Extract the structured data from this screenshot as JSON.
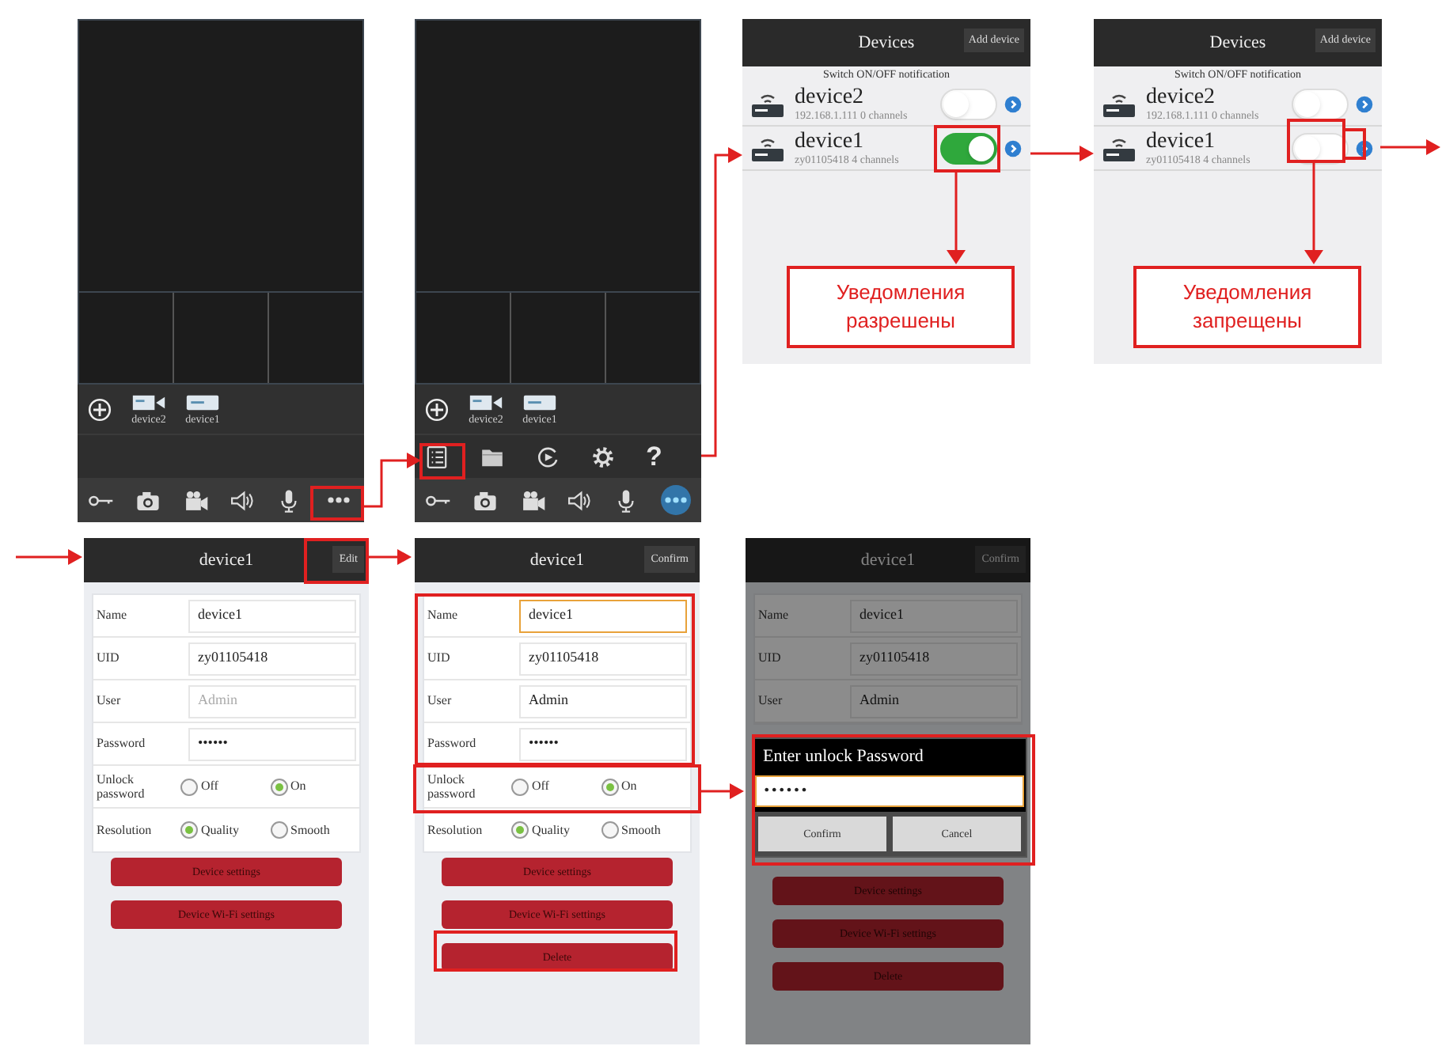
{
  "live_view_screens": [
    {
      "devices": [
        {
          "kind": "camera",
          "label": "device2"
        },
        {
          "kind": "recorder",
          "label": "device1"
        }
      ],
      "more_active": false
    },
    {
      "devices": [
        {
          "kind": "camera",
          "label": "device2"
        },
        {
          "kind": "recorder",
          "label": "device1"
        }
      ],
      "menu": [
        {
          "kind": "list"
        },
        {
          "kind": "folder"
        },
        {
          "kind": "playback"
        },
        {
          "kind": "settings"
        },
        {
          "kind": "help",
          "glyph": "?"
        }
      ],
      "more_active": true
    }
  ],
  "device_list_screens": [
    {
      "title": "Devices",
      "add_button": "Add device",
      "notice": "Switch ON/OFF notification",
      "devices": [
        {
          "name": "device2",
          "detail": "192.168.1.111 0 channels",
          "on": false
        },
        {
          "name": "device1",
          "detail": "zy01105418 4 channels",
          "on": true
        }
      ],
      "callout": "Уведомления разрешены"
    },
    {
      "title": "Devices",
      "add_button": "Add device",
      "notice": "Switch ON/OFF notification",
      "devices": [
        {
          "name": "device2",
          "detail": "192.168.1.111 0 channels",
          "on": false
        },
        {
          "name": "device1",
          "detail": "zy01105418 4 channels",
          "on": false
        }
      ],
      "callout": "Уведомления запрещены"
    }
  ],
  "device_edit_screens": [
    {
      "title": "device1",
      "action_button": "Edit",
      "fields": [
        {
          "label": "Name",
          "value": "device1",
          "focused": false
        },
        {
          "label": "UID",
          "value": "zy01105418",
          "focused": false
        },
        {
          "label": "User",
          "placeholder": "Admin",
          "focused": false
        },
        {
          "label": "Password",
          "value": "••••••",
          "focused": false
        }
      ],
      "options": [
        {
          "label": "Unlock password",
          "choices": [
            {
              "label": "Off",
              "selected": false
            },
            {
              "label": "On",
              "selected": true
            }
          ]
        },
        {
          "label": "Resolution",
          "choices": [
            {
              "label": "Quality",
              "selected": true
            },
            {
              "label": "Smooth",
              "selected": false
            }
          ]
        }
      ],
      "buttons": [
        "Device settings",
        "Device Wi-Fi settings"
      ]
    },
    {
      "title": "device1",
      "action_button": "Confirm",
      "fields": [
        {
          "label": "Name",
          "value": "device1",
          "focused": true
        },
        {
          "label": "UID",
          "value": "zy01105418",
          "focused": false
        },
        {
          "label": "User",
          "value": "Admin",
          "focused": false
        },
        {
          "label": "Password",
          "value": "••••••",
          "focused": false
        }
      ],
      "options": [
        {
          "label": "Unlock password",
          "choices": [
            {
              "label": "Off",
              "selected": false
            },
            {
              "label": "On",
              "selected": true
            }
          ]
        },
        {
          "label": "Resolution",
          "choices": [
            {
              "label": "Quality",
              "selected": true
            },
            {
              "label": "Smooth",
              "selected": false
            }
          ]
        }
      ],
      "buttons": [
        "Device settings",
        "Device Wi-Fi settings",
        "Delete"
      ]
    },
    {
      "title": "device1",
      "action_button": "Confirm",
      "fields": [
        {
          "label": "Name",
          "value": "device1",
          "focused": false
        },
        {
          "label": "UID",
          "value": "zy01105418",
          "focused": false
        },
        {
          "label": "User",
          "value": "Admin",
          "focused": false
        }
      ],
      "buttons": [
        "Device settings",
        "Device Wi-Fi settings",
        "Delete"
      ],
      "dialog": {
        "title": "Enter unlock Password",
        "value": "••••••",
        "buttons": [
          "Confirm",
          "Cancel"
        ]
      }
    }
  ]
}
